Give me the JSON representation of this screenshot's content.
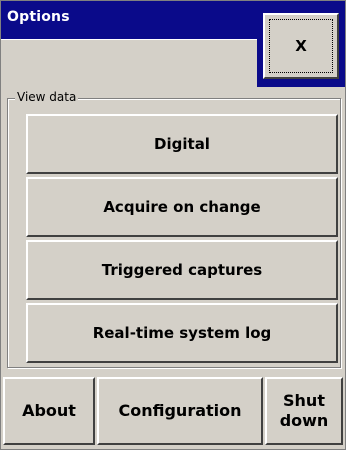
{
  "window": {
    "title": "Options",
    "close_label": "X"
  },
  "view_data": {
    "group_label": "View data",
    "buttons": [
      {
        "label": "Digital"
      },
      {
        "label": "Acquire on change"
      },
      {
        "label": "Triggered captures"
      },
      {
        "label": "Real-time system log"
      }
    ]
  },
  "bottom": {
    "about_label": "About",
    "configuration_label": "Configuration",
    "shutdown_label": "Shut\ndown"
  },
  "colors": {
    "title_bar": "#0a0a8a",
    "face": "#d4d0c8"
  }
}
